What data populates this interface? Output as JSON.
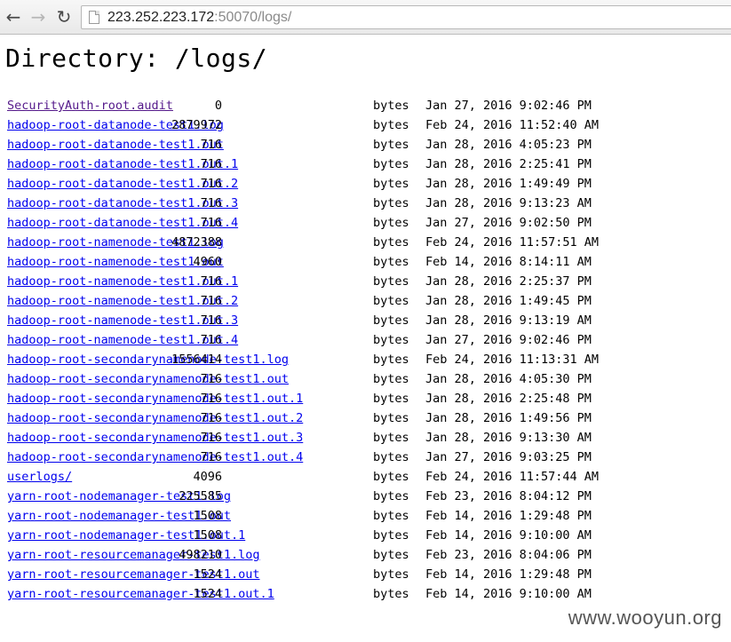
{
  "browser": {
    "url_host": "223.252.223.172",
    "url_port": ":50070",
    "url_path": "/logs/"
  },
  "page": {
    "title": "Directory: /logs/"
  },
  "files": [
    {
      "name": "SecurityAuth-root.audit",
      "size": "0",
      "unit": "bytes",
      "date": "Jan 27, 2016 9:02:46 PM"
    },
    {
      "name": "hadoop-root-datanode-test1.log",
      "size": "2879972",
      "unit": "bytes",
      "date": "Feb 24, 2016 11:52:40 AM"
    },
    {
      "name": "hadoop-root-datanode-test1.out",
      "size": "716",
      "unit": "bytes",
      "date": "Jan 28, 2016 4:05:23 PM"
    },
    {
      "name": "hadoop-root-datanode-test1.out.1",
      "size": "716",
      "unit": "bytes",
      "date": "Jan 28, 2016 2:25:41 PM"
    },
    {
      "name": "hadoop-root-datanode-test1.out.2",
      "size": "716",
      "unit": "bytes",
      "date": "Jan 28, 2016 1:49:49 PM"
    },
    {
      "name": "hadoop-root-datanode-test1.out.3",
      "size": "716",
      "unit": "bytes",
      "date": "Jan 28, 2016 9:13:23 AM"
    },
    {
      "name": "hadoop-root-datanode-test1.out.4",
      "size": "716",
      "unit": "bytes",
      "date": "Jan 27, 2016 9:02:50 PM"
    },
    {
      "name": "hadoop-root-namenode-test1.log",
      "size": "4872388",
      "unit": "bytes",
      "date": "Feb 24, 2016 11:57:51 AM"
    },
    {
      "name": "hadoop-root-namenode-test1.out",
      "size": "4960",
      "unit": "bytes",
      "date": "Feb 14, 2016 8:14:11 AM"
    },
    {
      "name": "hadoop-root-namenode-test1.out.1",
      "size": "716",
      "unit": "bytes",
      "date": "Jan 28, 2016 2:25:37 PM"
    },
    {
      "name": "hadoop-root-namenode-test1.out.2",
      "size": "716",
      "unit": "bytes",
      "date": "Jan 28, 2016 1:49:45 PM"
    },
    {
      "name": "hadoop-root-namenode-test1.out.3",
      "size": "716",
      "unit": "bytes",
      "date": "Jan 28, 2016 9:13:19 AM"
    },
    {
      "name": "hadoop-root-namenode-test1.out.4",
      "size": "716",
      "unit": "bytes",
      "date": "Jan 27, 2016 9:02:46 PM"
    },
    {
      "name": "hadoop-root-secondarynamenode-test1.log",
      "size": "1556414",
      "unit": "bytes",
      "date": "Feb 24, 2016 11:13:31 AM"
    },
    {
      "name": "hadoop-root-secondarynamenode-test1.out",
      "size": "716",
      "unit": "bytes",
      "date": "Jan 28, 2016 4:05:30 PM"
    },
    {
      "name": "hadoop-root-secondarynamenode-test1.out.1",
      "size": "716",
      "unit": "bytes",
      "date": "Jan 28, 2016 2:25:48 PM"
    },
    {
      "name": "hadoop-root-secondarynamenode-test1.out.2",
      "size": "716",
      "unit": "bytes",
      "date": "Jan 28, 2016 1:49:56 PM"
    },
    {
      "name": "hadoop-root-secondarynamenode-test1.out.3",
      "size": "716",
      "unit": "bytes",
      "date": "Jan 28, 2016 9:13:30 AM"
    },
    {
      "name": "hadoop-root-secondarynamenode-test1.out.4",
      "size": "716",
      "unit": "bytes",
      "date": "Jan 27, 2016 9:03:25 PM"
    },
    {
      "name": "userlogs/",
      "size": "4096",
      "unit": "bytes",
      "date": "Feb 24, 2016 11:57:44 AM"
    },
    {
      "name": "yarn-root-nodemanager-test1.log",
      "size": "225585",
      "unit": "bytes",
      "date": "Feb 23, 2016 8:04:12 PM"
    },
    {
      "name": "yarn-root-nodemanager-test1.out",
      "size": "1508",
      "unit": "bytes",
      "date": "Feb 14, 2016 1:29:48 PM"
    },
    {
      "name": "yarn-root-nodemanager-test1.out.1",
      "size": "1508",
      "unit": "bytes",
      "date": "Feb 14, 2016 9:10:00 AM"
    },
    {
      "name": "yarn-root-resourcemanager-test1.log",
      "size": "498210",
      "unit": "bytes",
      "date": "Feb 23, 2016 8:04:06 PM"
    },
    {
      "name": "yarn-root-resourcemanager-test1.out",
      "size": "1524",
      "unit": "bytes",
      "date": "Feb 14, 2016 1:29:48 PM"
    },
    {
      "name": "yarn-root-resourcemanager-test1.out.1",
      "size": "1524",
      "unit": "bytes",
      "date": "Feb 14, 2016 9:10:00 AM"
    }
  ],
  "watermark": "www.wooyun.org",
  "colors": {
    "link": "#0000ee",
    "visited_link": "#551a8b"
  },
  "icons": {
    "back": "back-arrow-icon",
    "forward": "forward-arrow-icon",
    "reload": "reload-icon",
    "page": "page-icon"
  }
}
